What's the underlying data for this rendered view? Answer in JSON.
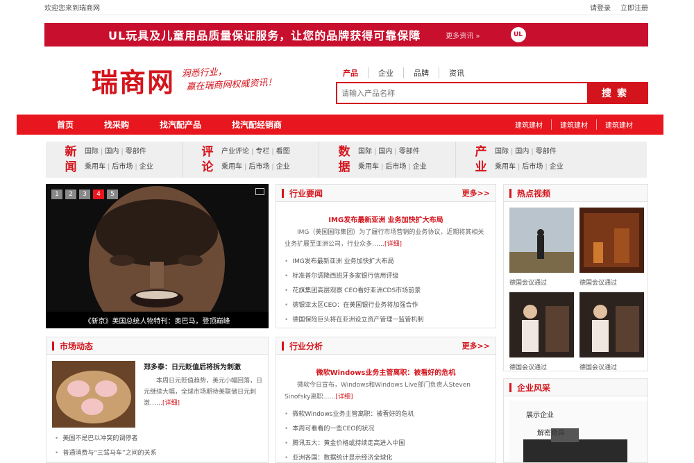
{
  "topbar": {
    "welcome": "欢迎您来到瑞商网",
    "login": "请登录",
    "register": "立即注册"
  },
  "banner": {
    "text": "UL玩具及儿童用品质量保证服务，让您的品牌获得可靠保障",
    "more": "更多资讯 »",
    "logo": "UL"
  },
  "header": {
    "logo": "瑞商网",
    "slogan": [
      "洞悉行业，",
      "赢在瑞商网权威资讯！"
    ],
    "search_tabs": [
      "产品",
      "企业",
      "品牌",
      "资讯"
    ],
    "search_placeholder": "请输入产品名称",
    "search_button": "搜索"
  },
  "nav": {
    "main": [
      "首页",
      "找采购",
      "找汽配产品",
      "找汽配经销商"
    ],
    "right": [
      "建筑建材",
      "建筑建材",
      "建筑建材"
    ]
  },
  "categories": [
    {
      "title": "新闻",
      "rows": [
        [
          "国际",
          "国内",
          "零部件"
        ],
        [
          "乘用车",
          "后市场",
          "企业"
        ]
      ]
    },
    {
      "title": "评论",
      "rows": [
        [
          "产业评论",
          "专栏",
          "看图"
        ],
        [
          "乘用车",
          "后市场",
          "企业"
        ]
      ]
    },
    {
      "title": "数据",
      "rows": [
        [
          "国际",
          "国内",
          "零部件"
        ],
        [
          "乘用车",
          "后市场",
          "企业"
        ]
      ]
    },
    {
      "title": "产业",
      "rows": [
        [
          "国际",
          "国内",
          "零部件"
        ],
        [
          "乘用车",
          "后市场",
          "企业"
        ]
      ]
    }
  ],
  "slider": {
    "pages": [
      "1",
      "2",
      "3",
      "4",
      "5"
    ],
    "active": 3,
    "caption": "《新京》美国总统人物特刊：奥巴马，登顶巅峰"
  },
  "industry_news": {
    "title": "行业要闻",
    "more": "更多>>",
    "headline": "IMG发布最新亚洲 业务加快扩大布局",
    "summary": "IMG（美国国际集团）为了履行市场营销的业务协议，近期将其相关业务扩展至亚洲公司，行业众多……",
    "detail": "[详细]",
    "items": [
      "IMG发布最新亚洲 业务加快扩大布局",
      "标准普尔调降西班牙多家银行信用评级",
      "花旗集团高层观察 CEO看好亚洲CDS市场前景",
      "德银亚太区CEO：在美国银行业务将加强合作",
      "德国保险巨头将在亚洲设立资产管理一监管机制"
    ]
  },
  "hot_video": {
    "title": "热点视频",
    "items": [
      {
        "caption": "德国会议通过"
      },
      {
        "caption": "德国会议通过"
      },
      {
        "caption": "德国会议通过"
      },
      {
        "caption": "德国会议通过"
      }
    ]
  },
  "market": {
    "title": "市场动态",
    "feature_title": "郑多泰：日元贬值后将拆为刺激",
    "feature_desc": "本周日元贬值趋势，美元小幅回落，日元继续大幅，全球市场期待美联储日元刺激……",
    "detail": "[详细]",
    "items": [
      "美国不是巴以冲突的调停者",
      "普通消费与“三驾马车”之间的关系"
    ]
  },
  "industry_analysis": {
    "title": "行业分析",
    "more": "更多>>",
    "headline": "微软Windows业务主管离职：被看好的危机",
    "summary": "微软今日宣布，Windows和Windows Live部门负责人Steven Sinofsky离职……",
    "detail": "[详细]",
    "items": [
      "微软Windows业务主管离职：被看好的危机",
      "本周可看看的一些CEO的状况",
      "腾讯五大：黄金价格或持续走高进入中国",
      "亚洲各国：数据统计显示经济全球化"
    ]
  },
  "company": {
    "title": "企业风采",
    "caption": "展示企业",
    "sub": "解密奇异"
  }
}
